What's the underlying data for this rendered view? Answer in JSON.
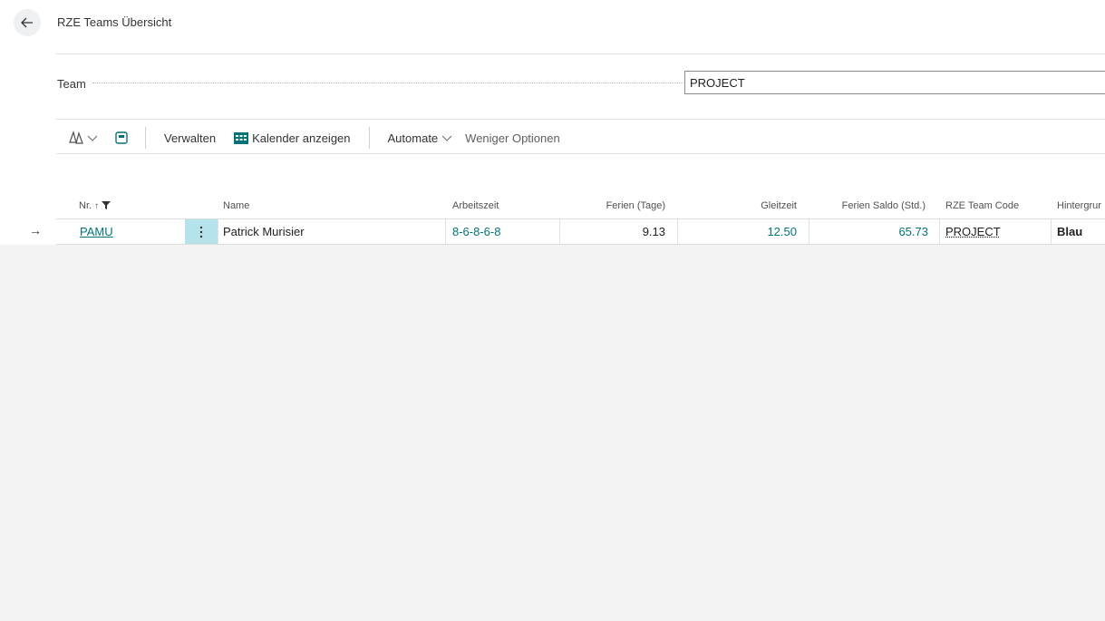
{
  "header": {
    "title": "RZE Teams Übersicht"
  },
  "filter": {
    "team_label": "Team",
    "team_value": "PROJECT"
  },
  "actions": {
    "manage_label": "Verwalten",
    "calendar_label": "Kalender anzeigen",
    "automate_label": "Automate",
    "fewer_options_label": "Weniger Optionen"
  },
  "table": {
    "columns": {
      "nr": "Nr.",
      "name": "Name",
      "arbeitszeit": "Arbeitszeit",
      "ferien_tage": "Ferien (Tage)",
      "gleitzeit": "Gleitzeit",
      "ferien_saldo": "Ferien Saldo (Std.)",
      "team_code": "RZE Team Code",
      "hintergrund": "Hintergrur"
    },
    "rows": [
      {
        "nr": "PAMU",
        "name": "Patrick Murisier",
        "arbeitszeit": "8-6-8-6-8",
        "ferien_tage": "9.13",
        "gleitzeit": "12.50",
        "ferien_saldo": "65.73",
        "team_code": "PROJECT",
        "hintergrund": "Blau"
      }
    ]
  },
  "icons": {
    "back": "back-arrow-icon",
    "copilot": "copilot-icon",
    "page_layout": "page-layout-icon",
    "calendar": "calendar-icon",
    "sort": "sort-ascending-icon",
    "filter": "filter-icon",
    "row_arrow": "row-arrow-icon",
    "row_menu": "more-vertical-icon"
  },
  "colors": {
    "accent": "#00747a",
    "row_menu_bg": "#b6e3eb",
    "empty_area": "#f3f3f3"
  }
}
